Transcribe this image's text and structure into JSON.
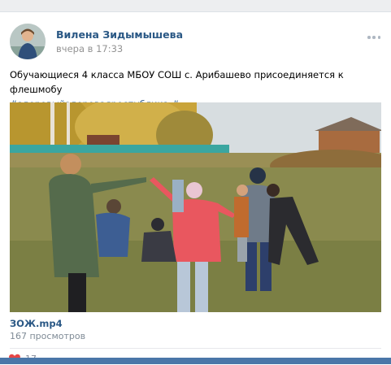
{
  "post": {
    "author": "Вилена Зидымышева",
    "time": "вчера в 17:33",
    "text": "Обучающиеся 4 класса МБОУ СОШ с. Арибашево присоединяется к флешмобу",
    "hashtag": "#здоровыйздороваяреспублика",
    "hashtag_suffix": " #"
  },
  "video": {
    "title": "ЗОЖ.mp4",
    "views": "167 просмотров"
  },
  "footer": {
    "likes": "17"
  },
  "icons": {
    "like": "heart-icon",
    "more": "more-dots-icon"
  },
  "colors": {
    "link": "#2a5885",
    "like": "#e64646",
    "accent": "#4a76a8"
  }
}
